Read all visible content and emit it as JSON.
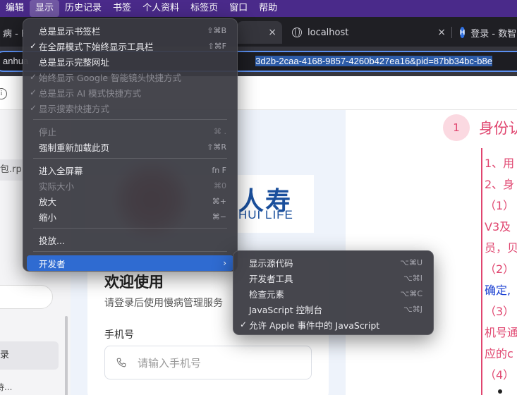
{
  "menubar": {
    "items": [
      "编辑",
      "显示",
      "历史记录",
      "书签",
      "个人资料",
      "标签页",
      "窗口",
      "帮助"
    ],
    "active_index": 1
  },
  "tabs": [
    {
      "label": "病 - F",
      "close": ""
    },
    {
      "label": "",
      "close": "×"
    },
    {
      "label": "localhost",
      "close": "×"
    },
    {
      "label": "登录 - 数智",
      "close": ""
    }
  ],
  "address": {
    "prefix": "anhua",
    "url": "3d2b-2caa-4168-9857-4260b427ea16&pid=87bb34bc-b8e"
  },
  "view_menu": {
    "groups": [
      [
        {
          "label": "总是显示书签栏",
          "shortcut": "⇧⌘B",
          "checked": false,
          "disabled": false
        },
        {
          "label": "在全屏模式下始终显示工具栏",
          "shortcut": "⇧⌘F",
          "checked": true,
          "disabled": false
        },
        {
          "label": "总是显示完整网址",
          "shortcut": "",
          "checked": false,
          "disabled": false
        },
        {
          "label": "始终显示 Google 智能镜头快捷方式",
          "shortcut": "",
          "checked": true,
          "disabled": true
        },
        {
          "label": "总是显示 AI 模式快捷方式",
          "shortcut": "",
          "checked": true,
          "disabled": true
        },
        {
          "label": "显示搜索快捷方式",
          "shortcut": "",
          "checked": true,
          "disabled": true
        }
      ],
      [
        {
          "label": "停止",
          "shortcut": "⌘ .",
          "checked": false,
          "disabled": true
        },
        {
          "label": "强制重新加载此页",
          "shortcut": "⇧⌘R",
          "checked": false,
          "disabled": false
        }
      ],
      [
        {
          "label": "进入全屏幕",
          "shortcut": "fn F",
          "checked": false,
          "disabled": false
        },
        {
          "label": "实际大小",
          "shortcut": "⌘0",
          "checked": false,
          "disabled": true
        },
        {
          "label": "放大",
          "shortcut": "⌘+",
          "checked": false,
          "disabled": false
        },
        {
          "label": "缩小",
          "shortcut": "⌘−",
          "checked": false,
          "disabled": false
        }
      ],
      [
        {
          "label": "投放...",
          "shortcut": "",
          "checked": false,
          "disabled": false
        }
      ],
      [
        {
          "label": "开发者",
          "shortcut": "",
          "checked": false,
          "disabled": false,
          "submenu": true,
          "highlighted": true
        }
      ]
    ]
  },
  "developer_menu": {
    "items": [
      {
        "label": "显示源代码",
        "shortcut": "⌥⌘U",
        "checked": false
      },
      {
        "label": "开发者工具",
        "shortcut": "⌥⌘I",
        "checked": false
      },
      {
        "label": "检查元素",
        "shortcut": "⌥⌘C",
        "checked": false
      },
      {
        "label": "JavaScript 控制台",
        "shortcut": "⌥⌘J",
        "checked": false
      },
      {
        "label": "允许 Apple 事件中的 JavaScript",
        "shortcut": "",
        "checked": true
      }
    ]
  },
  "left_panel": {
    "file_label": "包.rp",
    "item_label": "录",
    "footer_text": "待..."
  },
  "login": {
    "logo_cn": "人寿",
    "logo_en": "HUI LIFE",
    "title": "欢迎使用",
    "subtitle": "请登录后使用慢病管理服务",
    "phone_label": "手机号",
    "phone_placeholder": "请输入手机号"
  },
  "doc": {
    "step_number": "1",
    "step_title": "身份认",
    "lines": [
      {
        "text": "1、用",
        "color": "pink"
      },
      {
        "text": "2、身",
        "color": "pink"
      },
      {
        "text": "（1）",
        "color": "pink"
      },
      {
        "text": "V3及",
        "color": "pink"
      },
      {
        "text": "员，贝",
        "color": "pink"
      },
      {
        "text": "（2）",
        "color": "pink"
      },
      {
        "text": "确定,",
        "color": "blue"
      },
      {
        "text": "（3）",
        "color": "pink"
      },
      {
        "text": "机号通",
        "color": "pink"
      },
      {
        "text": "应的c",
        "color": "pink"
      },
      {
        "text": "（4）",
        "color": "pink"
      }
    ]
  }
}
